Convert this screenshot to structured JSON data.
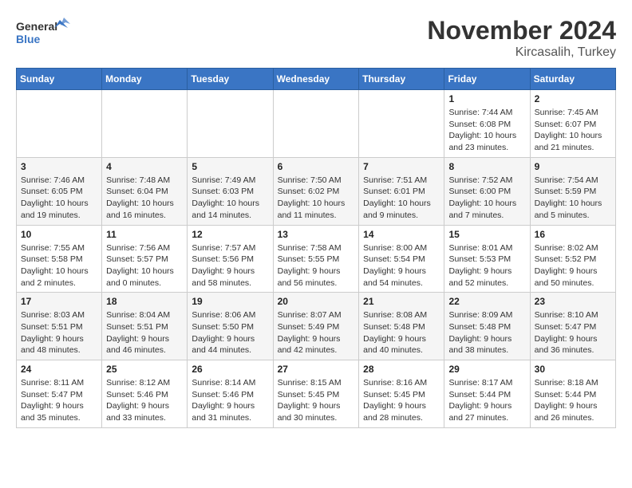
{
  "logo": {
    "text_general": "General",
    "text_blue": "Blue"
  },
  "header": {
    "month": "November 2024",
    "location": "Kircasalih, Turkey"
  },
  "days_of_week": [
    "Sunday",
    "Monday",
    "Tuesday",
    "Wednesday",
    "Thursday",
    "Friday",
    "Saturday"
  ],
  "weeks": [
    [
      {
        "day": "",
        "info": ""
      },
      {
        "day": "",
        "info": ""
      },
      {
        "day": "",
        "info": ""
      },
      {
        "day": "",
        "info": ""
      },
      {
        "day": "",
        "info": ""
      },
      {
        "day": "1",
        "info": "Sunrise: 7:44 AM\nSunset: 6:08 PM\nDaylight: 10 hours and 23 minutes."
      },
      {
        "day": "2",
        "info": "Sunrise: 7:45 AM\nSunset: 6:07 PM\nDaylight: 10 hours and 21 minutes."
      }
    ],
    [
      {
        "day": "3",
        "info": "Sunrise: 7:46 AM\nSunset: 6:05 PM\nDaylight: 10 hours and 19 minutes."
      },
      {
        "day": "4",
        "info": "Sunrise: 7:48 AM\nSunset: 6:04 PM\nDaylight: 10 hours and 16 minutes."
      },
      {
        "day": "5",
        "info": "Sunrise: 7:49 AM\nSunset: 6:03 PM\nDaylight: 10 hours and 14 minutes."
      },
      {
        "day": "6",
        "info": "Sunrise: 7:50 AM\nSunset: 6:02 PM\nDaylight: 10 hours and 11 minutes."
      },
      {
        "day": "7",
        "info": "Sunrise: 7:51 AM\nSunset: 6:01 PM\nDaylight: 10 hours and 9 minutes."
      },
      {
        "day": "8",
        "info": "Sunrise: 7:52 AM\nSunset: 6:00 PM\nDaylight: 10 hours and 7 minutes."
      },
      {
        "day": "9",
        "info": "Sunrise: 7:54 AM\nSunset: 5:59 PM\nDaylight: 10 hours and 5 minutes."
      }
    ],
    [
      {
        "day": "10",
        "info": "Sunrise: 7:55 AM\nSunset: 5:58 PM\nDaylight: 10 hours and 2 minutes."
      },
      {
        "day": "11",
        "info": "Sunrise: 7:56 AM\nSunset: 5:57 PM\nDaylight: 10 hours and 0 minutes."
      },
      {
        "day": "12",
        "info": "Sunrise: 7:57 AM\nSunset: 5:56 PM\nDaylight: 9 hours and 58 minutes."
      },
      {
        "day": "13",
        "info": "Sunrise: 7:58 AM\nSunset: 5:55 PM\nDaylight: 9 hours and 56 minutes."
      },
      {
        "day": "14",
        "info": "Sunrise: 8:00 AM\nSunset: 5:54 PM\nDaylight: 9 hours and 54 minutes."
      },
      {
        "day": "15",
        "info": "Sunrise: 8:01 AM\nSunset: 5:53 PM\nDaylight: 9 hours and 52 minutes."
      },
      {
        "day": "16",
        "info": "Sunrise: 8:02 AM\nSunset: 5:52 PM\nDaylight: 9 hours and 50 minutes."
      }
    ],
    [
      {
        "day": "17",
        "info": "Sunrise: 8:03 AM\nSunset: 5:51 PM\nDaylight: 9 hours and 48 minutes."
      },
      {
        "day": "18",
        "info": "Sunrise: 8:04 AM\nSunset: 5:51 PM\nDaylight: 9 hours and 46 minutes."
      },
      {
        "day": "19",
        "info": "Sunrise: 8:06 AM\nSunset: 5:50 PM\nDaylight: 9 hours and 44 minutes."
      },
      {
        "day": "20",
        "info": "Sunrise: 8:07 AM\nSunset: 5:49 PM\nDaylight: 9 hours and 42 minutes."
      },
      {
        "day": "21",
        "info": "Sunrise: 8:08 AM\nSunset: 5:48 PM\nDaylight: 9 hours and 40 minutes."
      },
      {
        "day": "22",
        "info": "Sunrise: 8:09 AM\nSunset: 5:48 PM\nDaylight: 9 hours and 38 minutes."
      },
      {
        "day": "23",
        "info": "Sunrise: 8:10 AM\nSunset: 5:47 PM\nDaylight: 9 hours and 36 minutes."
      }
    ],
    [
      {
        "day": "24",
        "info": "Sunrise: 8:11 AM\nSunset: 5:47 PM\nDaylight: 9 hours and 35 minutes."
      },
      {
        "day": "25",
        "info": "Sunrise: 8:12 AM\nSunset: 5:46 PM\nDaylight: 9 hours and 33 minutes."
      },
      {
        "day": "26",
        "info": "Sunrise: 8:14 AM\nSunset: 5:46 PM\nDaylight: 9 hours and 31 minutes."
      },
      {
        "day": "27",
        "info": "Sunrise: 8:15 AM\nSunset: 5:45 PM\nDaylight: 9 hours and 30 minutes."
      },
      {
        "day": "28",
        "info": "Sunrise: 8:16 AM\nSunset: 5:45 PM\nDaylight: 9 hours and 28 minutes."
      },
      {
        "day": "29",
        "info": "Sunrise: 8:17 AM\nSunset: 5:44 PM\nDaylight: 9 hours and 27 minutes."
      },
      {
        "day": "30",
        "info": "Sunrise: 8:18 AM\nSunset: 5:44 PM\nDaylight: 9 hours and 26 minutes."
      }
    ]
  ]
}
